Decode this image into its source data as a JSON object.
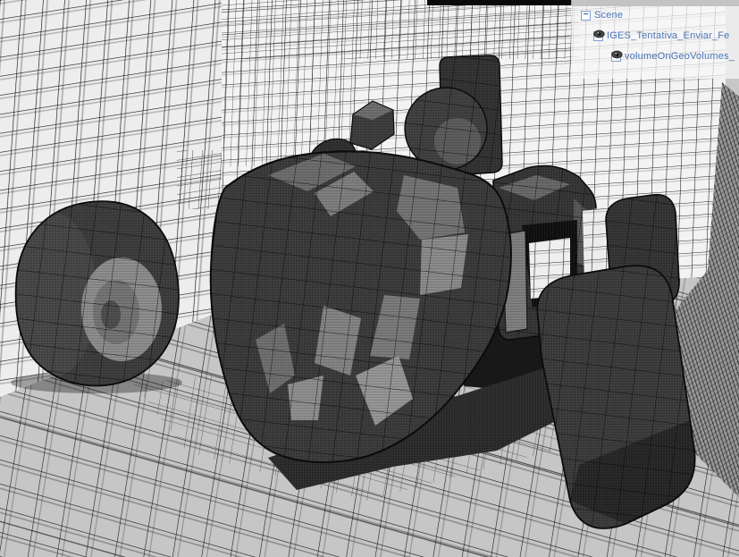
{
  "scene_tree": {
    "glyphs": {
      "collapse": "−",
      "expand": "+"
    },
    "rows": [
      {
        "label": "Scene",
        "expander": "collapse",
        "visibility_icon": false
      },
      {
        "label": "IGES_Tentativa_Enviar_Fe",
        "expander": "collapse",
        "visibility_icon": true
      },
      {
        "label": "volumeOnGeoVolumes_",
        "expander": "expand",
        "visibility_icon": true
      }
    ],
    "colors": {
      "label_text": "#4a76b8",
      "expander_border": "#7e9cd2",
      "top_strip": "#c3c3c3",
      "panel_background": "rgba(247,247,247,0.74)"
    }
  },
  "viewport": {
    "colors": {
      "left_wall": "#ededed",
      "back_wall": "#f3f3f3",
      "right_wall_dark": "#989898",
      "floor": "#c6c6c6",
      "grid_line": "#1a1a1a",
      "mesh_surface_dark": "#3a3a3a",
      "mesh_surface_light": "#8c8c8c",
      "wheel_hub": "#8d8d8d",
      "shadow": "#181818",
      "ceiling_strip": "#0a0a0a"
    },
    "objects": [
      "front-left-wheel",
      "car-body",
      "cockpit-mound",
      "mirror",
      "helmet",
      "headrest-plate",
      "engine-cover",
      "suspension-strut",
      "rear-right-wheel",
      "rear-left-wheel"
    ]
  }
}
